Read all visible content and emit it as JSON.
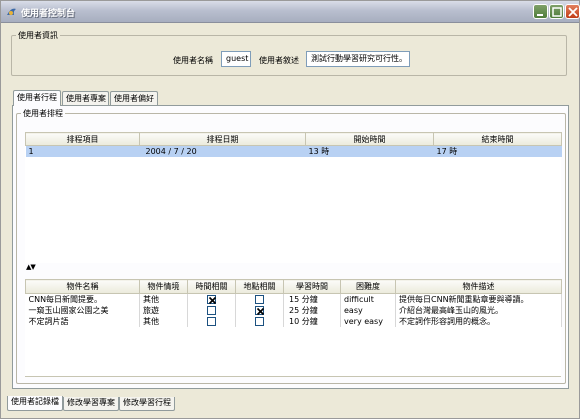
{
  "window": {
    "title": "使用者控制台"
  },
  "user_info": {
    "legend": "使用者資訊",
    "name_label": "使用者名稱",
    "name_value": "guest",
    "desc_label": "使用者敘述",
    "desc_value": "測試行動學習研究可行性。"
  },
  "top_tabs": [
    "使用者行程",
    "使用者專案",
    "使用者偏好"
  ],
  "schedule": {
    "legend": "使用者排程",
    "columns": [
      "排程項目",
      "排程日期",
      "開始時間",
      "結束時間"
    ],
    "rows": [
      {
        "item": "1",
        "date": "2004 / 7 / 20",
        "start": "13 時",
        "end": "17 時"
      }
    ],
    "sort_arrows": "▲▼"
  },
  "objects": {
    "columns": [
      "物件名稱",
      "物件情境",
      "時間相關",
      "地點相關",
      "學習時間",
      "困難度",
      "物件描述"
    ],
    "rows": [
      {
        "name": "CNN每日新聞提要。",
        "context": "其他",
        "time_related": true,
        "place_related": false,
        "duration": "15 分鐘",
        "difficulty": "difficult",
        "description": "提供每日CNN新聞重點章要與導讀。"
      },
      {
        "name": "一窺玉山國家公園之美",
        "context": "旅遊",
        "time_related": false,
        "place_related": true,
        "duration": "25 分鐘",
        "difficulty": "easy",
        "description": "介紹台灣最高峰玉山的風光。"
      },
      {
        "name": "不定詞片語",
        "context": "其他",
        "time_related": false,
        "place_related": false,
        "duration": "10 分鐘",
        "difficulty": "very easy",
        "description": "不定詞作形容詞用的概念。"
      }
    ]
  },
  "bottom_tabs": [
    "使用者記錄檔",
    "修改學習專案",
    "修改學習行程"
  ],
  "colors": {
    "selection": "#b8d1f3",
    "close_button": "#c13c16"
  }
}
